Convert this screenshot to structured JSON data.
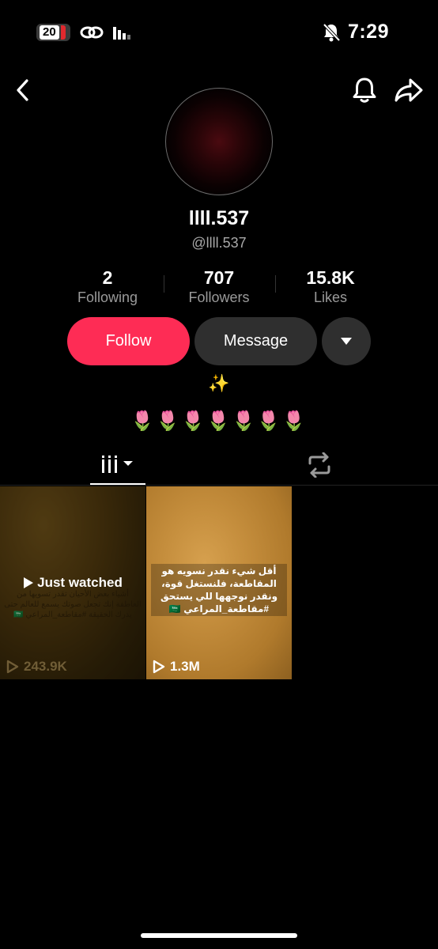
{
  "status_bar": {
    "notification_count": "20",
    "time": "7:29",
    "icons": [
      "chain-link-icon",
      "signal-bars-icon",
      "bell-muted-icon"
    ]
  },
  "nav": {
    "icons": [
      "back-chevron-icon",
      "bell-icon",
      "share-icon"
    ]
  },
  "profile": {
    "display_name": "llll.537",
    "handle": "@llll.537"
  },
  "stats": {
    "following": {
      "value": "2",
      "label": "Following"
    },
    "followers": {
      "value": "707",
      "label": "Followers"
    },
    "likes": {
      "value": "15.8K",
      "label": "Likes"
    }
  },
  "actions": {
    "follow_label": "Follow",
    "message_label": "Message",
    "more_icon": "triangle-down-icon"
  },
  "bio": {
    "line1": "✨",
    "line2": "🌷🌷🌷🌷🌷🌷🌷"
  },
  "tabs": {
    "videos_icon": "grid-bars-icon",
    "reposts_icon": "repost-icon"
  },
  "videos": [
    {
      "badge": "Just watched",
      "caption": "أشياء بعض الأحيان تقدر تسويها من العاطفة إنك تجعل صوتك يسمع للعالم حتى يدرك الحقيقة #مقاطعة_المراعي 🇸🇦",
      "views": "243.9K"
    },
    {
      "badge": "",
      "caption": "أقل شيء نقدر نسويه هو المقاطعة، فلنستغل قوة، ونقدر نوجهها للي يستحق #مقاطعة_المراعي 🇸🇦",
      "views": "1.3M"
    }
  ],
  "colors": {
    "background": "#000000",
    "follow_button": "#fe2c55",
    "secondary_button": "#2f2f2f",
    "muted_text": "#9a9a9a"
  }
}
